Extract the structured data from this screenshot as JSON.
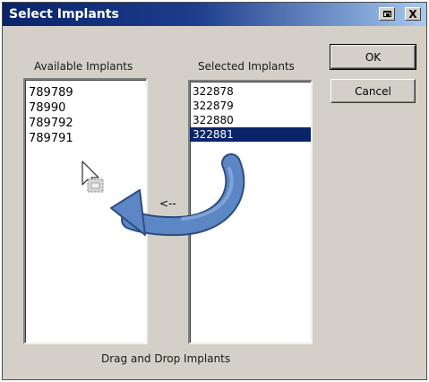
{
  "window": {
    "title": "Select Implants",
    "close_glyph": "X",
    "title_bar_colors": [
      "#0a246a",
      "#a6caf0"
    ]
  },
  "labels": {
    "available": "Available Implants",
    "selected": "Selected Implants",
    "drag_drop": "Drag and Drop Implants",
    "arrow": "<--"
  },
  "available_list": [
    "789789",
    "78990",
    "789792",
    "789791"
  ],
  "selected_list": [
    {
      "value": "322878",
      "selected": false
    },
    {
      "value": "322879",
      "selected": false
    },
    {
      "value": "322880",
      "selected": false
    },
    {
      "value": "322881",
      "selected": true
    }
  ],
  "buttons": {
    "ok": "OK",
    "cancel": "Cancel"
  },
  "annotation": {
    "arrow_color": "#4f7ab8",
    "cursor": "drag-copy-cursor-icon"
  }
}
